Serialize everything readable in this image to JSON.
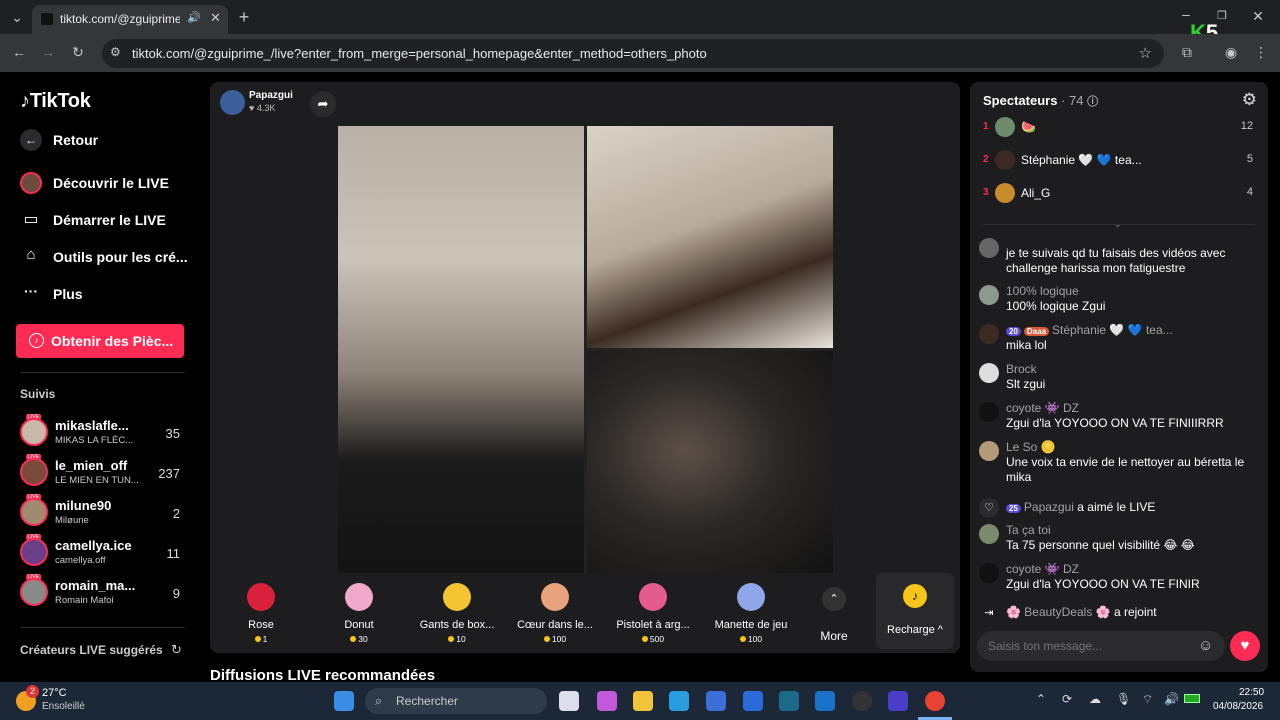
{
  "browser": {
    "tab_title": "tiktok.com/@zguiprime_/liv",
    "url": "tiktok.com/@zguiprime_/live?enter_from_merge=personal_homepage&enter_method=others_photo",
    "overlay_logo": "K5"
  },
  "sidebar": {
    "logo": "TikTok",
    "back_label": "Retour",
    "nav": [
      {
        "label": "Découvrir le LIVE",
        "icon": "live-avatar-icon"
      },
      {
        "label": "Démarrer le LIVE",
        "icon": "camera-icon"
      },
      {
        "label": "Outils pour les cré...",
        "icon": "creator-tools-icon"
      },
      {
        "label": "Plus",
        "icon": "more-dots-icon"
      }
    ],
    "coins_button": "Obtenir des Pièc...",
    "follow_header": "Suivis",
    "following": [
      {
        "name": "mikaslafle...",
        "sub": "MIKAS LA FLÈC...",
        "count": "35"
      },
      {
        "name": "le_mien_off",
        "sub": "LE MIEN EN TUN...",
        "count": "237"
      },
      {
        "name": "milune90",
        "sub": "Miløune",
        "count": "2"
      },
      {
        "name": "camellya.ice",
        "sub": "camellya.off",
        "count": "11"
      },
      {
        "name": "romain_ma...",
        "sub": "Romain Mafoi",
        "count": "9"
      }
    ],
    "suggested_header": "Créateurs LIVE suggérés",
    "live_badge": "LIVE"
  },
  "live": {
    "host_name": "Papazgui",
    "host_likes": "4.3K",
    "gifts": [
      {
        "name": "Rose",
        "price": "1",
        "color": "#d9213b"
      },
      {
        "name": "Donut",
        "price": "30",
        "color": "#f0a8c8"
      },
      {
        "name": "Gants de box...",
        "price": "10",
        "color": "#f4c531"
      },
      {
        "name": "Cœur dans le...",
        "price": "100",
        "color": "#e8a27c"
      },
      {
        "name": "Pistolet à arg...",
        "price": "500",
        "color": "#e45b8c"
      },
      {
        "name": "Manette de jeu",
        "price": "100",
        "color": "#8fa7e8"
      }
    ],
    "more_label": "More",
    "recharge_label": "Recharge ^"
  },
  "recommended_header": "Diffusions LIVE recommandées",
  "panel": {
    "title": "Spectateurs",
    "count": "· 74",
    "top_viewers": [
      {
        "rank": "1",
        "name": "🍉",
        "score": "12"
      },
      {
        "rank": "2",
        "name": "Stéphanie 🤍 💙 tea...",
        "score": "5"
      },
      {
        "rank": "3",
        "name": "Ali_G",
        "score": "4"
      }
    ],
    "messages": [
      {
        "user": "",
        "text": "je te suivais qd tu faisais des vidéos avec challenge harissa mon fatiguestre"
      },
      {
        "user": "100% logique",
        "text": "100% logique Zgui"
      },
      {
        "user": "Stéphanie 🤍 💙 tea...",
        "lvl": "20",
        "team": "Daaa",
        "text": "mika lol"
      },
      {
        "user": "Brock",
        "text": "Slt zgui"
      },
      {
        "user": "coyote 👾 DZ",
        "text": "Zgui d'la YOYOOO ON VA TE FINIIIRRR"
      },
      {
        "user": "Le So 🪙",
        "text": "Une voix ta envie de le nettoyer au béretta le mika"
      },
      {
        "user": "Papazgui",
        "lvl": "25",
        "text": "a aimé le LIVE"
      },
      {
        "user": "Ta ça toi",
        "text": "Ta 75 personne quel visibilité 😂 😂"
      },
      {
        "user": "coyote 👾 DZ",
        "text": "Zgui d'la YOYOOO ON VA TE FINIR"
      },
      {
        "user": "🌸 BeautyDeals 🌸",
        "text": "a rejoint"
      }
    ],
    "input_placeholder": "Saisis ton message..."
  },
  "taskbar": {
    "weather_temp": "27°C",
    "weather_text": "Ensoleillé",
    "notif_count": "2",
    "search_placeholder": "Rechercher",
    "time": "22:50",
    "date": "04/08/2026"
  }
}
